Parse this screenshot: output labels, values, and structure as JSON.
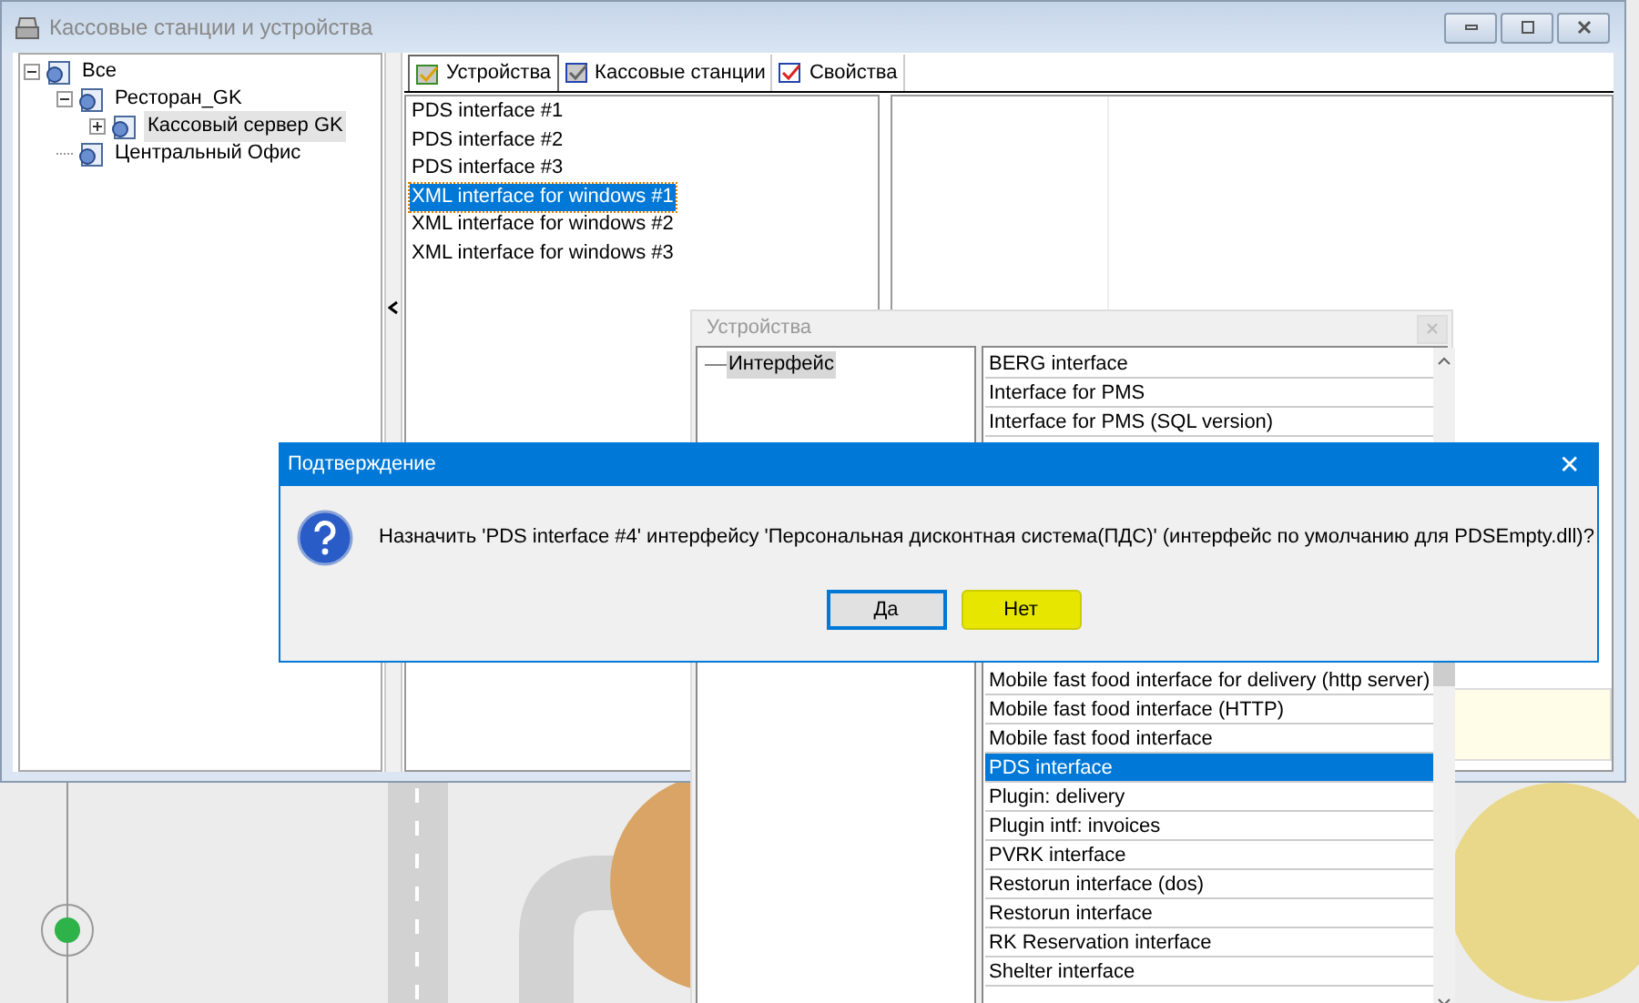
{
  "main_window": {
    "title": "Кассовые станции и устройства"
  },
  "tree": [
    {
      "label": "Все",
      "expanded": true,
      "selected": false,
      "children": [
        {
          "label": "Ресторан_GK",
          "expanded": true,
          "selected": false,
          "children": [
            {
              "label": "Кассовый сервер GK",
              "expanded": false,
              "selected": true
            }
          ]
        },
        {
          "label": "Центральный Офис",
          "selected": false
        }
      ]
    }
  ],
  "tabs": [
    {
      "label": "Устройства",
      "selected": true
    },
    {
      "label": "Кассовые станции",
      "selected": false
    },
    {
      "label": "Свойства",
      "selected": false
    }
  ],
  "devices": [
    {
      "label": "PDS interface #1",
      "selected": false
    },
    {
      "label": "PDS interface #2",
      "selected": false
    },
    {
      "label": "PDS interface #3",
      "selected": false
    },
    {
      "label": "XML interface for windows #1",
      "selected": true
    },
    {
      "label": "XML interface for windows #2",
      "selected": false
    },
    {
      "label": "XML interface for windows #3",
      "selected": false
    }
  ],
  "device_dialog": {
    "title": "Устройства",
    "tree_item": "Интерфейс",
    "list_top": [
      {
        "label": "BERG interface",
        "selected": false
      },
      {
        "label": "Interface for PMS",
        "selected": false
      },
      {
        "label": "Interface for PMS (SQL version)",
        "selected": false
      }
    ],
    "list_bottom": [
      {
        "label": "Mobile fast food interface for delivery (http server)",
        "selected": false
      },
      {
        "label": "Mobile fast food interface (HTTP)",
        "selected": false
      },
      {
        "label": "Mobile fast food interface",
        "selected": false
      },
      {
        "label": "PDS interface",
        "selected": true
      },
      {
        "label": "Plugin: delivery",
        "selected": false
      },
      {
        "label": "Plugin intf: invoices",
        "selected": false
      },
      {
        "label": "PVRK interface",
        "selected": false
      },
      {
        "label": "Restorun interface (dos)",
        "selected": false
      },
      {
        "label": "Restorun interface",
        "selected": false
      },
      {
        "label": "RK Reservation interface",
        "selected": false
      },
      {
        "label": "Shelter interface",
        "selected": false
      }
    ]
  },
  "confirm_dialog": {
    "title": "Подтверждение",
    "close": "✕",
    "message": "Назначить 'PDS interface #4' интерфейсу 'Персональная дисконтная система(ПДС)' (интерфейс по умолчанию для PDSEmpty.dll)?",
    "buttons": [
      {
        "label": "Да",
        "highlighted": false
      },
      {
        "label": "Нет",
        "highlighted": true
      }
    ]
  }
}
